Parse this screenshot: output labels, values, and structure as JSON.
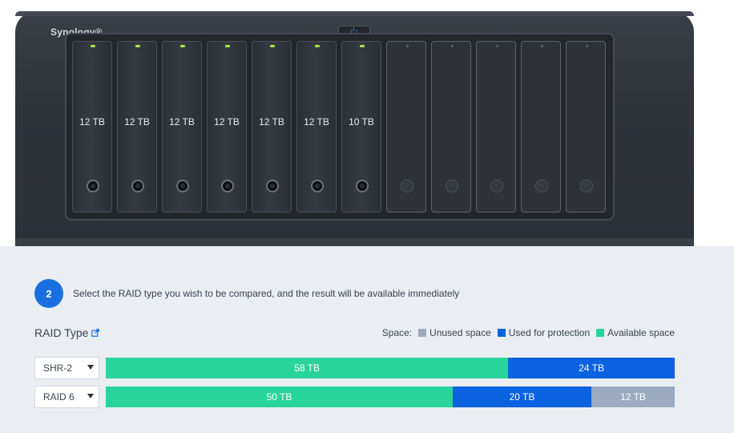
{
  "nas": {
    "brand": "Synology®",
    "bays": [
      {
        "label": "12 TB",
        "filled": true
      },
      {
        "label": "12 TB",
        "filled": true
      },
      {
        "label": "12 TB",
        "filled": true
      },
      {
        "label": "12 TB",
        "filled": true
      },
      {
        "label": "12 TB",
        "filled": true
      },
      {
        "label": "12 TB",
        "filled": true
      },
      {
        "label": "10 TB",
        "filled": true
      },
      {
        "label": "",
        "filled": false
      },
      {
        "label": "",
        "filled": false
      },
      {
        "label": "",
        "filled": false
      },
      {
        "label": "",
        "filled": false
      },
      {
        "label": "",
        "filled": false
      }
    ]
  },
  "step": {
    "number": "2",
    "text": "Select the RAID type you wish to be compared, and the result will be available immediately"
  },
  "raid": {
    "title": "RAID Type"
  },
  "legend": {
    "label": "Space:",
    "unused": "Unused space",
    "protection": "Used for protection",
    "available": "Available space"
  },
  "colors": {
    "unused": "#9aabc2",
    "protection": "#0b62e0",
    "available": "#29d49b"
  },
  "rows": [
    {
      "raid_type": "SHR-2",
      "available": "58 TB",
      "protection": "24 TB",
      "unused": "",
      "available_tb": 58,
      "protection_tb": 24,
      "unused_tb": 0
    },
    {
      "raid_type": "RAID 6",
      "available": "50 TB",
      "protection": "20 TB",
      "unused": "12 TB",
      "available_tb": 50,
      "protection_tb": 20,
      "unused_tb": 12
    }
  ]
}
